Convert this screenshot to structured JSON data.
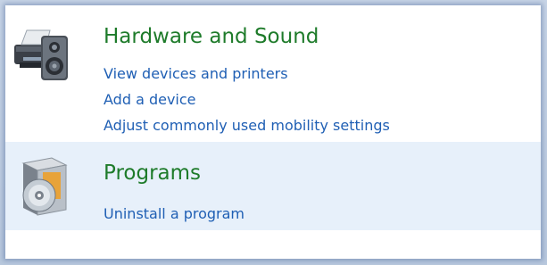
{
  "categories": [
    {
      "title": "Hardware and Sound",
      "icon": "printer-speaker-icon",
      "links": [
        "View devices and printers",
        "Add a device",
        "Adjust commonly used mobility settings"
      ]
    },
    {
      "title": "Programs",
      "icon": "programs-disc-icon",
      "links": [
        "Uninstall a program"
      ]
    }
  ],
  "colors": {
    "title": "#1e7b2a",
    "link": "#1f5fb4",
    "hover_bg": "#e7f0fa",
    "frame": "#c7d4e6"
  }
}
